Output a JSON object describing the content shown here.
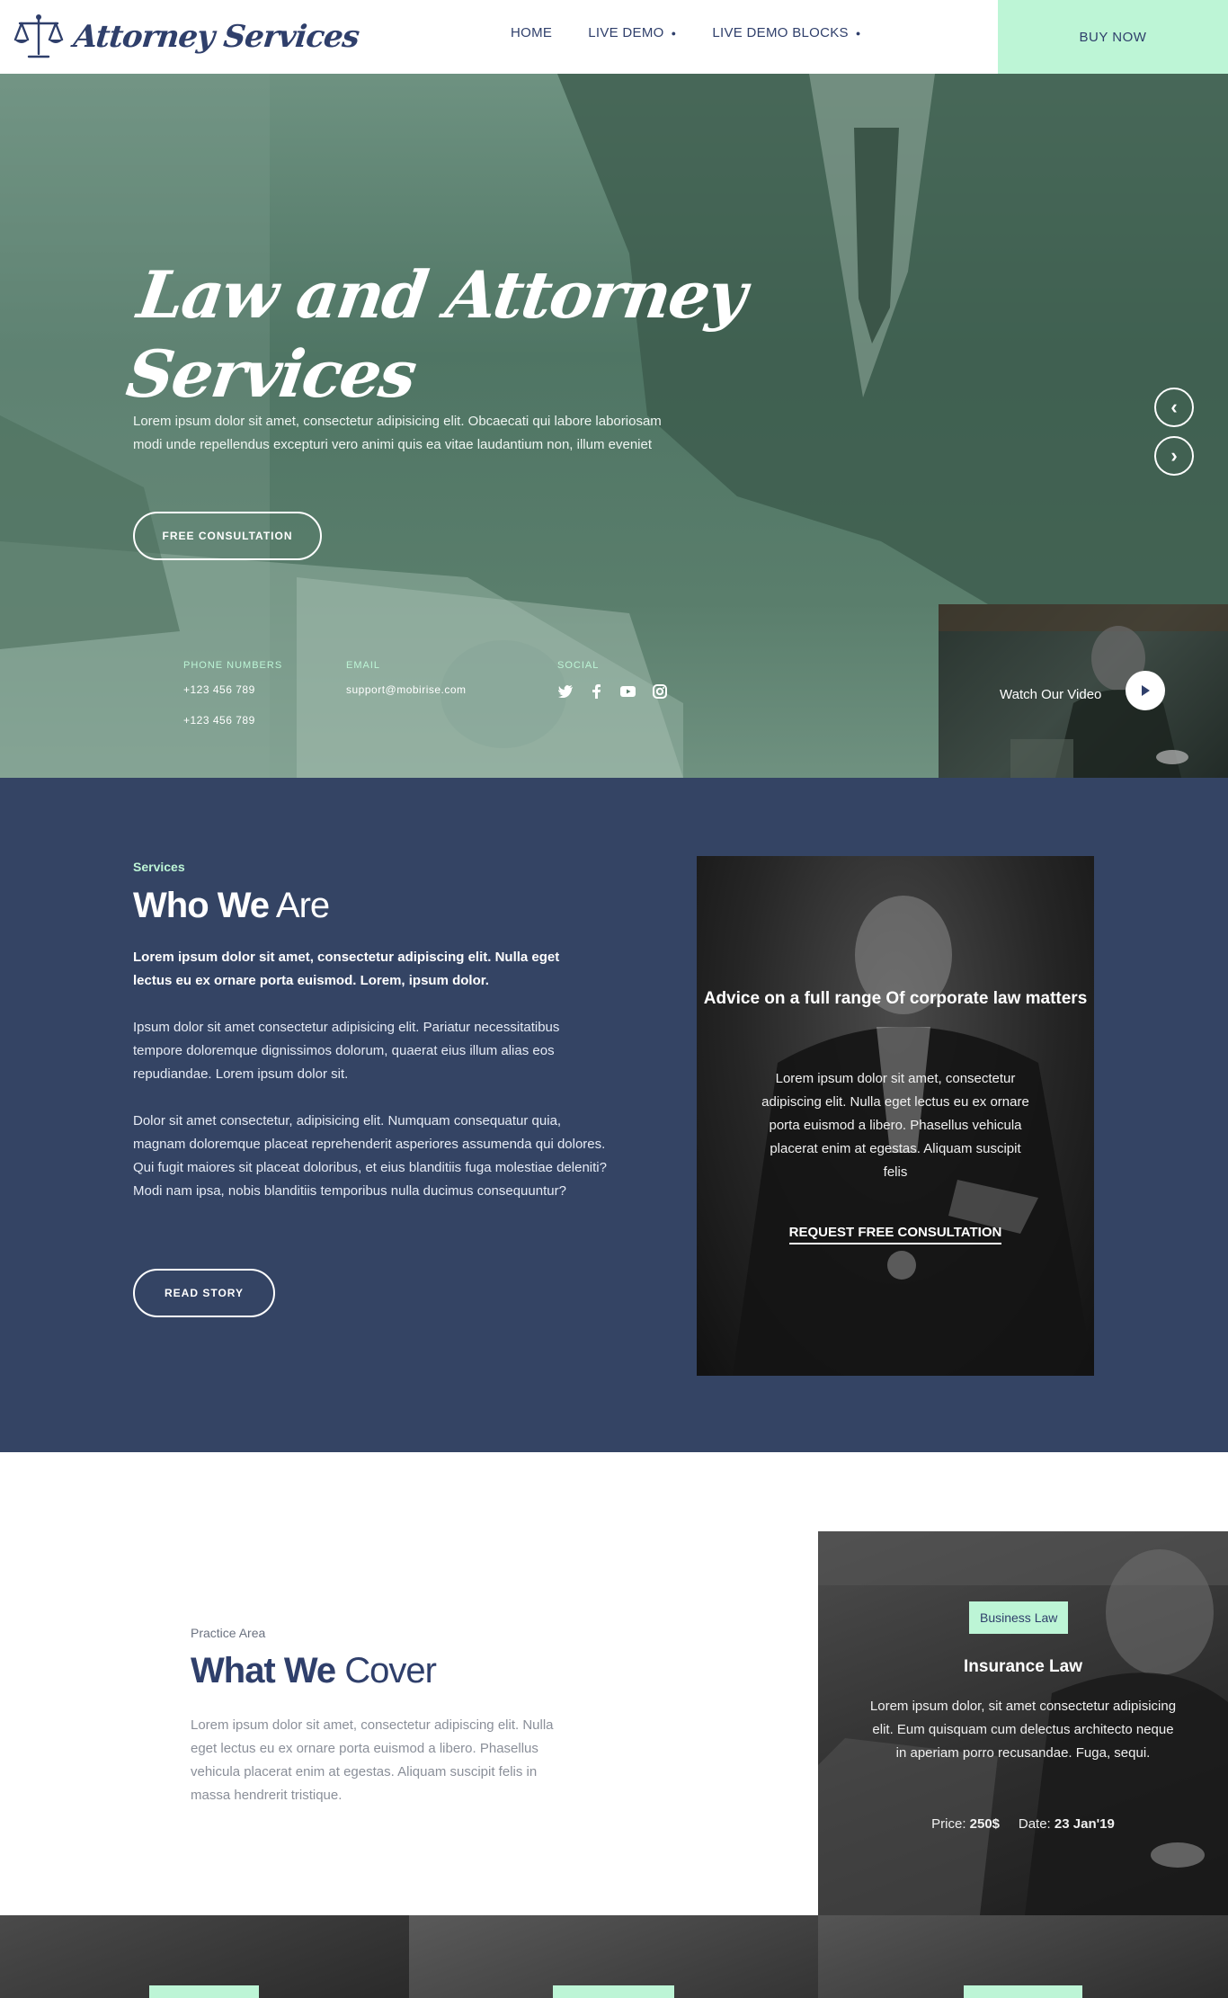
{
  "navbar": {
    "brand": "Attorney Services",
    "items": [
      {
        "label": "HOME",
        "caret": false
      },
      {
        "label": "LIVE DEMO",
        "caret": true
      },
      {
        "label": "LIVE DEMO BLOCKS",
        "caret": true
      }
    ],
    "buy_label": "BUY NOW"
  },
  "hero": {
    "title": "Law and Attorney Services",
    "text": "Lorem ipsum dolor sit amet, consectetur adipisicing elit. Obcaecati qui labore laboriosam modi unde repellendus excepturi vero animi quis ea vitae laudantium non, illum eveniet",
    "button": "FREE CONSULTATION",
    "phone_label": "PHONE NUMBERS",
    "phones": [
      "+123 456 789",
      "+123 456 789"
    ],
    "email_label": "EMAIL",
    "email": "support@mobirise.com",
    "social_label": "SOCIAL",
    "social_icons": [
      "twitter-icon",
      "facebook-icon",
      "youtube-icon",
      "instagram-icon"
    ],
    "video_label": "Watch Our Video"
  },
  "who": {
    "tag": "Services",
    "title_bold": "Who We",
    "title_light": "Are",
    "lead": "Lorem ipsum dolor sit amet, consectetur adipiscing elit. Nulla eget lectus eu ex ornare porta euismod. Lorem, ipsum dolor.",
    "para1": "Ipsum dolor sit amet consectetur adipisicing elit. Pariatur necessitatibus tempore doloremque dignissimos dolorum, quaerat eius illum alias eos repudiandae. Lorem ipsum dolor sit.",
    "para2": "Dolor sit amet consectetur, adipisicing elit. Numquam consequatur quia, magnam doloremque placeat reprehenderit asperiores assumenda qui dolores. Qui fugit maiores sit placeat doloribus, et eius blanditiis fuga molestiae deleniti? Modi nam ipsa, nobis blanditiis temporibus nulla ducimus consequuntur?",
    "button": "READ STORY",
    "card_title": "Advice on a full range Of corporate law matters",
    "card_text": "Lorem ipsum dolor sit amet, consectetur adipiscing elit. Nulla eget lectus eu ex ornare porta euismod a libero. Phasellus vehicula placerat enim at egestas. Aliquam suscipit felis",
    "card_link": "REQUEST FREE CONSULTATION"
  },
  "cover": {
    "tag": "Practice Area",
    "title_bold": "What We",
    "title_light": "Cover",
    "text": "Lorem ipsum dolor sit amet, consectetur adipiscing elit. Nulla eget lectus eu ex ornare porta euismod a libero. Phasellus vehicula placerat enim at egestas. Aliquam suscipit felis in massa hendrerit tristique.",
    "card": {
      "badge": "Business Law",
      "title": "Insurance Law",
      "text": "Lorem ipsum dolor, sit amet consectetur adipisicing elit. Eum quisquam cum delectus architecto neque in aperiam porro recusandae. Fuga, sequi.",
      "price_label": "Price:",
      "price": "250$",
      "date_label": "Date:",
      "date": "23 Jan'19"
    }
  },
  "colors": {
    "navy": "#344464",
    "mint": "#bdf5d6",
    "hero_green": "#4f7564"
  }
}
